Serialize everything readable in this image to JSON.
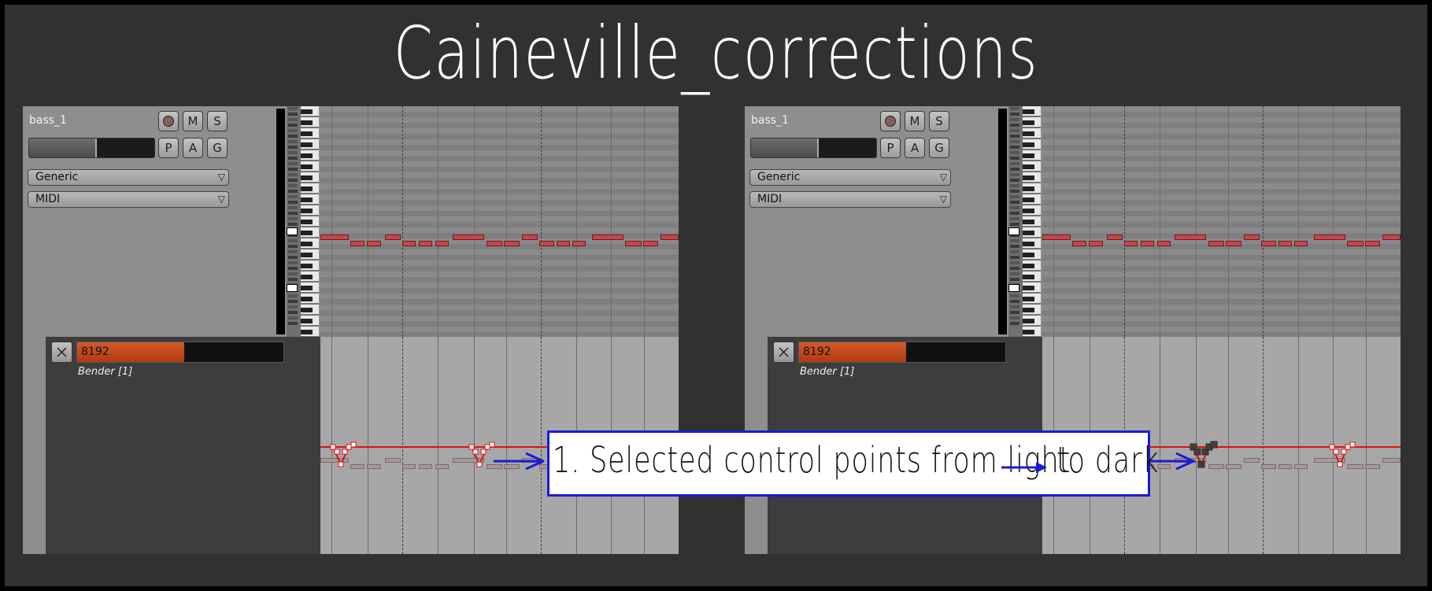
{
  "title": "Caineville_corrections",
  "panels": [
    {
      "track_name": "bass_1",
      "buttons": {
        "mute": "M",
        "solo": "S",
        "playlist": "P",
        "automation": "A",
        "group": "G"
      },
      "instrument": "Generic",
      "mode": "MIDI",
      "controller_value": "8192",
      "controller_name": "Bender [1]"
    },
    {
      "track_name": "bass_1",
      "buttons": {
        "mute": "M",
        "solo": "S",
        "playlist": "P",
        "automation": "A",
        "group": "G"
      },
      "instrument": "Generic",
      "mode": "MIDI",
      "controller_value": "8192",
      "controller_name": "Bender [1]"
    }
  ],
  "callout": {
    "text": "1.  Selected control points from light",
    "text_end": "to dark"
  },
  "colors": {
    "accent_arrow": "#1b1bd6",
    "note": "#c9444d",
    "automation_line": "#e01010",
    "controller_fill": "#c0441a"
  },
  "icons": [
    "record-icon",
    "close-icon",
    "dropdown-arrow-icon",
    "arrow-right-icon"
  ]
}
